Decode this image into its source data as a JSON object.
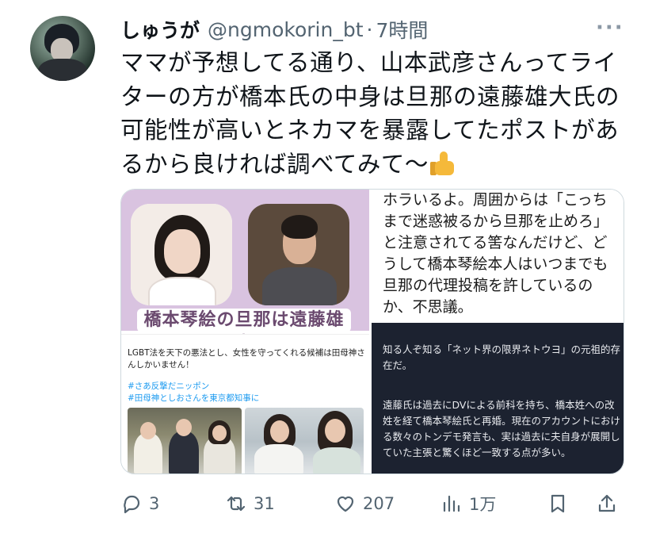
{
  "author": {
    "name": "しゅうが",
    "handle": "@ngmokorin_bt",
    "separator": "·",
    "time": "7時間"
  },
  "tweet": {
    "text": "ママが予想してる通り、山本武彦さんってライターの方が橋本氏の中身は旦那の遠藤雄大氏の可能性が高いとネカマを暴露してたポストがあるから良ければ調べてみて〜",
    "emoji_icon": "thumbs-up-icon"
  },
  "media": {
    "panel1_caption": "橋本琴絵の旦那は遠藤雄大",
    "panel2_text": "ホラいるよ。周囲からは「こっちまで迷惑被るから旦那を止めろ」と注意されてる筈なんだけど、どうして橋本琴絵本人はいつまでも旦那の代理投稿を許しているのか、不思議。",
    "panel3_text": "LGBT法を天下の悪法とし、女性を守ってくれる候補は田母神さんしかいません！",
    "panel3_tags": "#さあ反撃だニッポン\n#田母神としおさんを東京都知事に",
    "panel4_text_1": "知る人ぞ知る「ネット界の限界ネトウヨ」の元祖的存在だ。",
    "panel4_text_2": "遠藤氏は過去にDVによる前科を持ち、橋本姓への改姓を経て橋本琴絵氏と再婚。現在のアカウントにおける数々のトンデモ発言も、実は過去に夫自身が展開していた主張と驚くほど一致する点が多い。"
  },
  "actions": {
    "replies": "3",
    "reposts": "31",
    "likes": "207",
    "views": "1万"
  },
  "colors": {
    "secondary_text": "#536471",
    "panel1_bg": "#d9c3e0",
    "panel4_bg": "#1c2230"
  }
}
